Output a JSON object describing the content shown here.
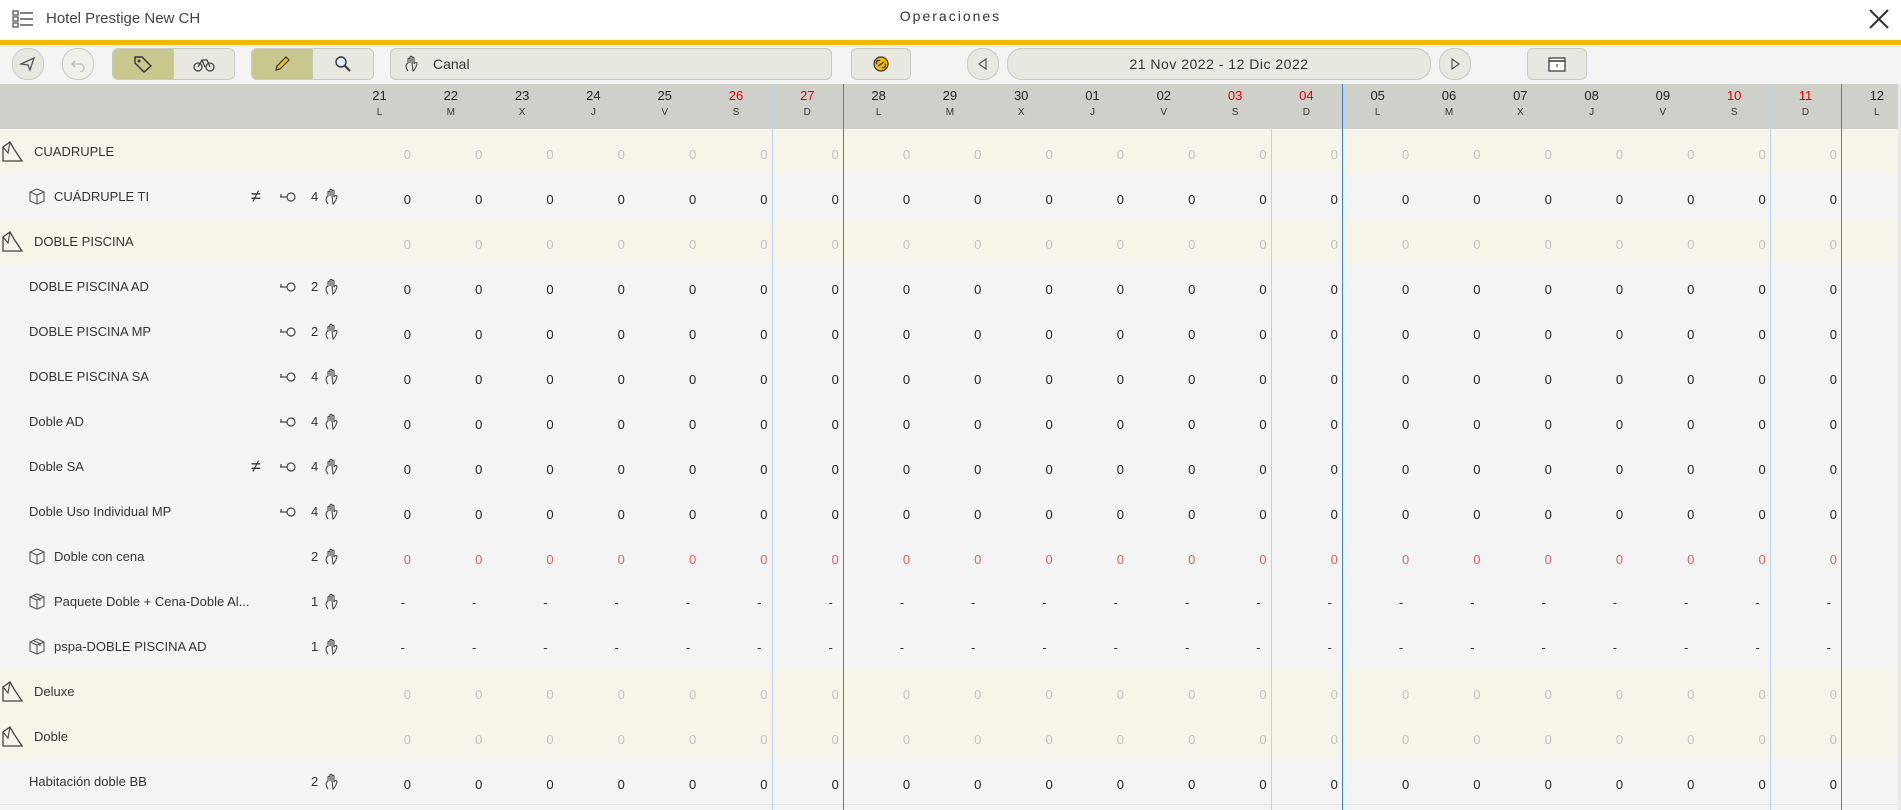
{
  "app": {
    "hotel_name": "Hotel Prestige New CH",
    "title": "Operaciones"
  },
  "toolbar": {
    "channel_placeholder": "Canal",
    "date_range": "21 Nov 2022 - 12 Dic 2022",
    "accent": "#f5b800"
  },
  "days": [
    {
      "num": "21",
      "wd": "L",
      "weekend": false
    },
    {
      "num": "22",
      "wd": "M",
      "weekend": false
    },
    {
      "num": "23",
      "wd": "X",
      "weekend": false
    },
    {
      "num": "24",
      "wd": "J",
      "weekend": false
    },
    {
      "num": "25",
      "wd": "V",
      "weekend": false
    },
    {
      "num": "26",
      "wd": "S",
      "weekend": true
    },
    {
      "num": "27",
      "wd": "D",
      "weekend": true
    },
    {
      "num": "28",
      "wd": "L",
      "weekend": false
    },
    {
      "num": "29",
      "wd": "M",
      "weekend": false
    },
    {
      "num": "30",
      "wd": "X",
      "weekend": false
    },
    {
      "num": "01",
      "wd": "J",
      "weekend": false
    },
    {
      "num": "02",
      "wd": "V",
      "weekend": false
    },
    {
      "num": "03",
      "wd": "S",
      "weekend": true
    },
    {
      "num": "04",
      "wd": "D",
      "weekend": true
    },
    {
      "num": "05",
      "wd": "L",
      "weekend": false
    },
    {
      "num": "06",
      "wd": "M",
      "weekend": false
    },
    {
      "num": "07",
      "wd": "X",
      "weekend": false
    },
    {
      "num": "08",
      "wd": "J",
      "weekend": false
    },
    {
      "num": "09",
      "wd": "V",
      "weekend": false
    },
    {
      "num": "10",
      "wd": "S",
      "weekend": true
    },
    {
      "num": "11",
      "wd": "D",
      "weekend": true
    },
    {
      "num": "12",
      "wd": "L",
      "weekend": false
    }
  ],
  "rows": [
    {
      "type": "group",
      "label": "CUADRUPLE",
      "value": "0"
    },
    {
      "type": "item",
      "label": "CUÁDRUPLE TI",
      "icon": "box",
      "neq": true,
      "key": true,
      "count": "4",
      "hand": true,
      "value": "0",
      "style": "normal"
    },
    {
      "type": "group",
      "label": "DOBLE PISCINA",
      "value": "0"
    },
    {
      "type": "item",
      "label": "DOBLE PISCINA AD",
      "icon": "",
      "neq": false,
      "key": true,
      "count": "2",
      "hand": true,
      "value": "0",
      "style": "normal"
    },
    {
      "type": "item",
      "label": "DOBLE PISCINA MP",
      "icon": "",
      "neq": false,
      "key": true,
      "count": "2",
      "hand": true,
      "value": "0",
      "style": "normal"
    },
    {
      "type": "item",
      "label": "DOBLE PISCINA SA",
      "icon": "",
      "neq": false,
      "key": true,
      "count": "4",
      "hand": true,
      "value": "0",
      "style": "normal"
    },
    {
      "type": "item",
      "label": "Doble AD",
      "icon": "",
      "neq": false,
      "key": true,
      "count": "4",
      "hand": true,
      "value": "0",
      "style": "normal"
    },
    {
      "type": "item",
      "label": "Doble SA",
      "icon": "",
      "neq": true,
      "key": true,
      "count": "4",
      "hand": true,
      "value": "0",
      "style": "normal"
    },
    {
      "type": "item",
      "label": "Doble Uso Individual MP",
      "icon": "",
      "neq": false,
      "key": true,
      "count": "4",
      "hand": true,
      "value": "0",
      "style": "normal"
    },
    {
      "type": "item",
      "label": "Doble con cena",
      "icon": "box",
      "neq": false,
      "key": false,
      "count": "2",
      "hand": true,
      "value": "0",
      "style": "red"
    },
    {
      "type": "item",
      "label": "Paquete Doble + Cena-Doble Al...",
      "icon": "package",
      "neq": false,
      "key": false,
      "count": "1",
      "hand": true,
      "value": "-",
      "style": "dash"
    },
    {
      "type": "item",
      "label": "pspa-DOBLE PISCINA AD",
      "icon": "package",
      "neq": false,
      "key": false,
      "count": "1",
      "hand": true,
      "value": "-",
      "style": "dash"
    },
    {
      "type": "group",
      "label": "Deluxe",
      "value": "0"
    },
    {
      "type": "group",
      "label": "Doble",
      "value": "0"
    },
    {
      "type": "item",
      "label": "Habitación doble BB",
      "icon": "",
      "neq": false,
      "key": false,
      "count": "2",
      "hand": true,
      "value": "0",
      "style": "normal"
    }
  ]
}
